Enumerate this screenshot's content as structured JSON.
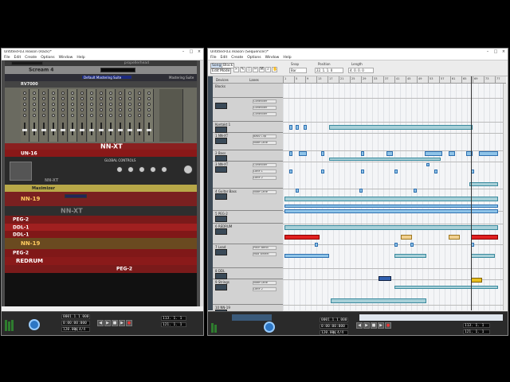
{
  "left_window": {
    "title": "Untitled-03.reason (Rack)*",
    "menu": [
      "File",
      "Edit",
      "Create",
      "Options",
      "Window",
      "Help"
    ],
    "brand": "propellerhead",
    "devices": [
      {
        "label": "Scream 4",
        "color": "#8a8a8a"
      },
      {
        "label": "Default Mastering Suite",
        "color": "#2e2e36"
      },
      {
        "label": "Mastering Suite",
        "color": "#444"
      },
      {
        "label": "RV7000",
        "color": "#3a3a3a"
      },
      {
        "label": "NN-XT",
        "color": "#8a2020"
      },
      {
        "label": "UN-16",
        "color": "#8a1818"
      },
      {
        "label": "NN-XT",
        "color": "#2a2a2a"
      },
      {
        "label": "Maximizer",
        "color": "#b8a848"
      },
      {
        "label": "NN-19",
        "color": "#7a2020"
      },
      {
        "label": "NN-XT",
        "color": "#2e2e2e"
      },
      {
        "label": "PEG-2",
        "color": "#7a1a1a"
      },
      {
        "label": "DDL-1",
        "color": "#a02020"
      },
      {
        "label": "DDL-1",
        "color": "#801818"
      },
      {
        "label": "NN-19",
        "color": "#6a4a20"
      },
      {
        "label": "PEG-2",
        "color": "#801818"
      },
      {
        "label": "REDRUM",
        "color": "#8a1a1a"
      },
      {
        "label": "PEG-2",
        "color": "#7a1a1a"
      }
    ],
    "mixer_title": "GLOBAL CONTROLS",
    "transport": {
      "position": "0001.1.1.000",
      "time": "0:00:00:000",
      "tempo_label": "120.000",
      "sig_label": "4/4",
      "loop_left": "1. 1. 1. 0",
      "loop_right": "5. 1. 1. 0",
      "bars_a": "113. 1. 1",
      "bars_b": "121. 1. 1"
    }
  },
  "right_window": {
    "title": "Untitled-03.reason (Sequencer)*",
    "menu": [
      "File",
      "Edit",
      "Create",
      "Options",
      "Window",
      "Help"
    ],
    "mode_buttons": [
      "Song",
      "Block",
      "Edit Mode"
    ],
    "snap_label": "Snap",
    "snap_value": "Bar",
    "position_label": "Position",
    "position_value": "22. 1. 1. 0",
    "length_label": "Length",
    "length_value": "4. 0. 0. 0",
    "col_devices": "Devices",
    "col_lanes": "Lanes",
    "ruler_ticks": [
      "1",
      "5",
      "9",
      "13",
      "17",
      "21",
      "25",
      "29",
      "33",
      "37",
      "41",
      "45",
      "49",
      "53",
      "57",
      "61",
      "65",
      "69",
      "73",
      "77"
    ],
    "tracks": [
      {
        "name": "Blocks",
        "lanes": []
      },
      {
        "name": "",
        "lanes": [
          "Controller",
          "Controller",
          "Controller"
        ]
      },
      {
        "name": "Kontakt 1",
        "lanes": []
      },
      {
        "name": "1 NN-XT",
        "lanes": [
          "Bass Clip",
          "Note Lane"
        ]
      },
      {
        "name": "2 Bass",
        "lanes": []
      },
      {
        "name": "3 NN-XT",
        "lanes": [
          "Controller",
          "Lane 1",
          "Lane 2"
        ]
      },
      {
        "name": "4 Guitar Bass",
        "lanes": [
          "Note Lane"
        ]
      },
      {
        "name": "5 PEG-2",
        "lanes": []
      },
      {
        "name": "6 REDRUM",
        "lanes": []
      },
      {
        "name": "7 Lead",
        "lanes": [
          "Pitch Bend",
          "Mod Wheel"
        ]
      },
      {
        "name": "8 DDL",
        "lanes": []
      },
      {
        "name": "9 Strings",
        "lanes": [
          "Note Lane",
          "Lane 2"
        ]
      },
      {
        "name": "10 NN-19",
        "lanes": []
      }
    ],
    "transport": {
      "position": "0001.1.1.000",
      "time": "0:00:00:000",
      "tempo_label": "120.000",
      "sig_label": "4/4",
      "loop_left": "1. 1. 1. 0",
      "loop_right": "5. 1. 1. 0",
      "bars_a": "113. 1. 1",
      "bars_b": "121. 1. 1"
    }
  }
}
